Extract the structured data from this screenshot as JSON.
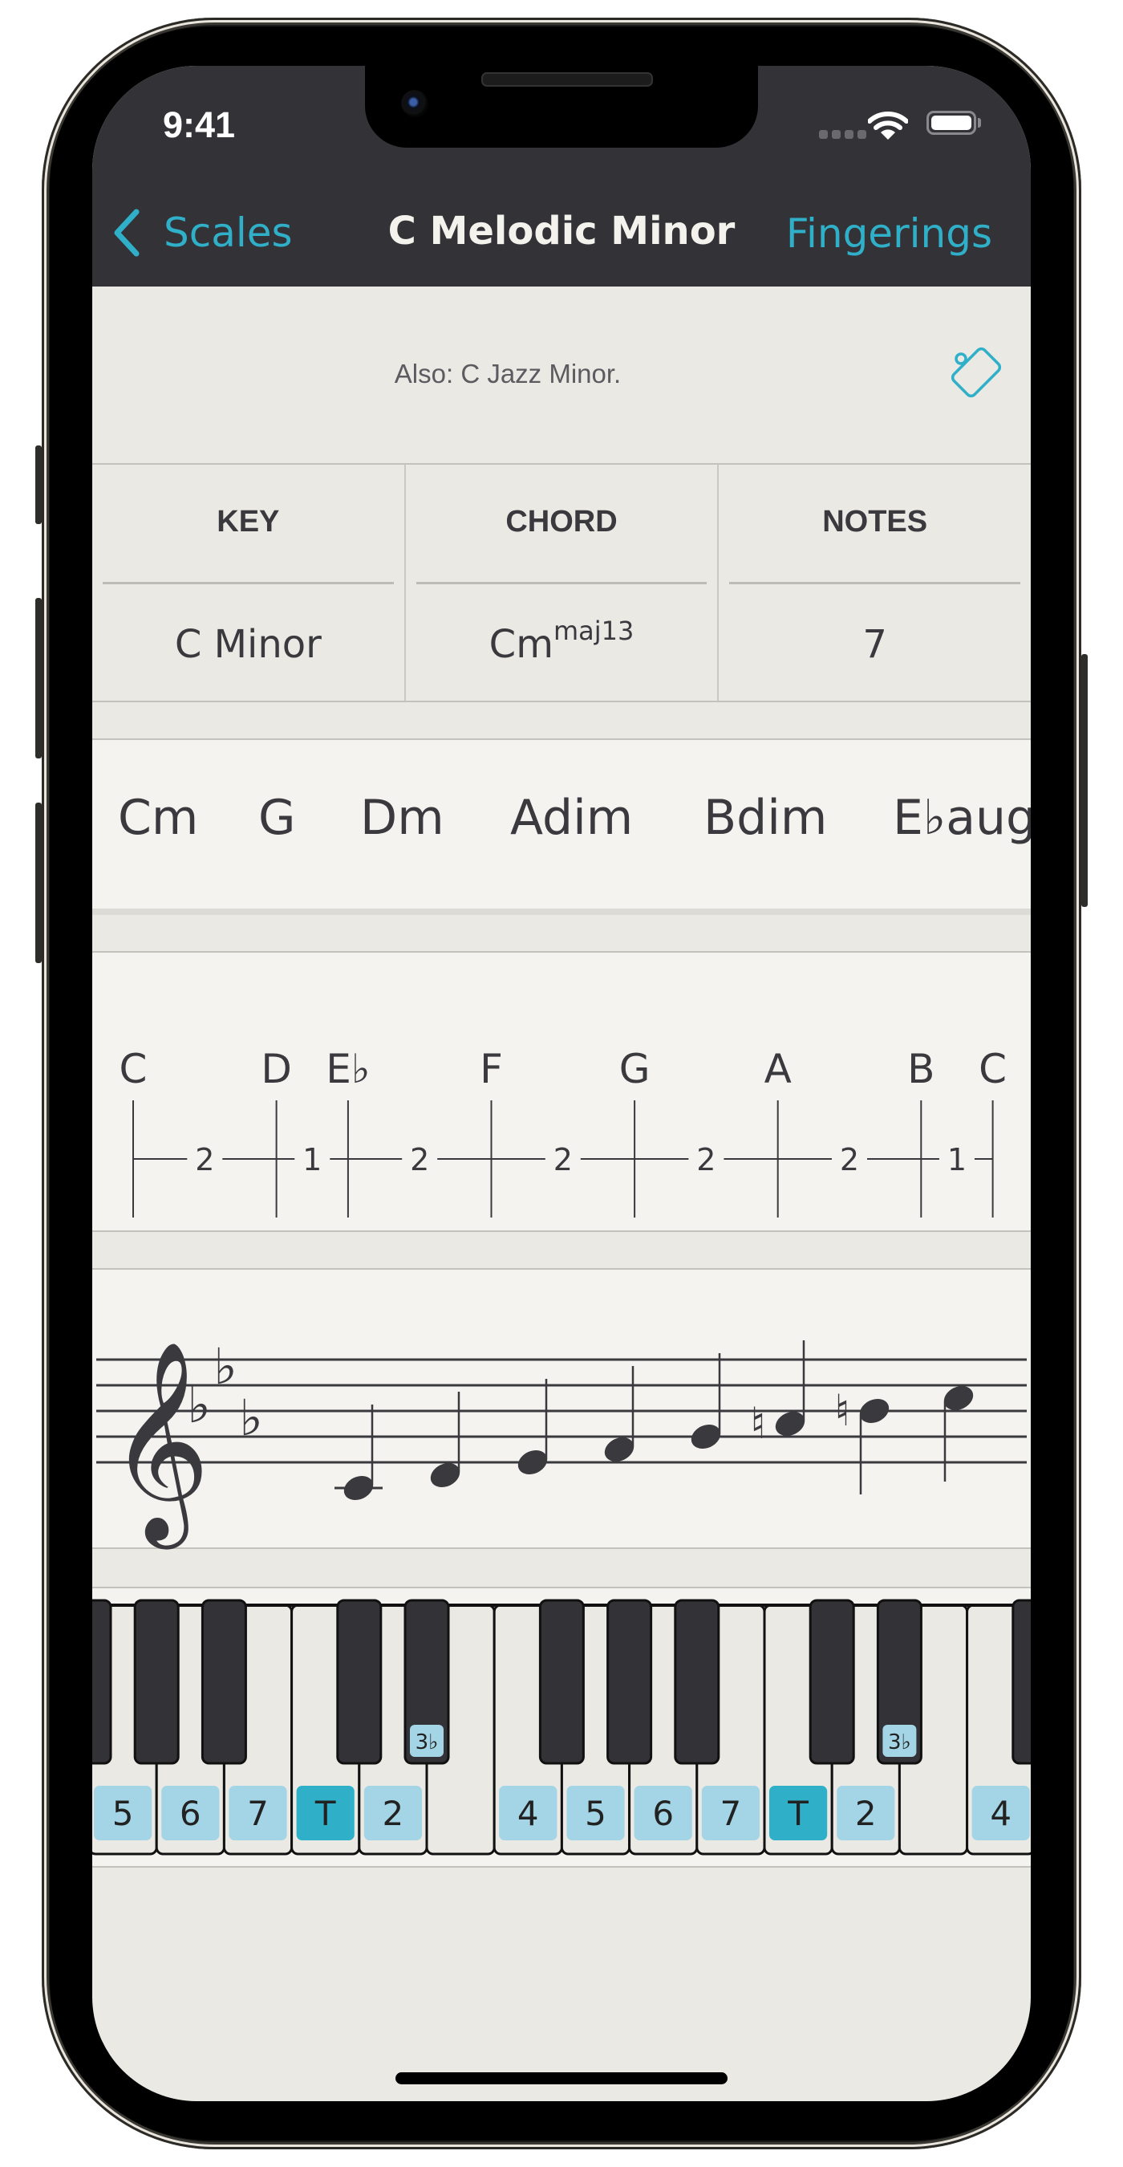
{
  "status_bar": {
    "time": "9:41",
    "signal_bars": 0,
    "wifi": "wifi-icon",
    "battery": "battery-full-icon"
  },
  "nav": {
    "back_label": "Scales",
    "title": "C Melodic Minor",
    "right_label": "Fingerings",
    "accent_color": "#2fb0c8"
  },
  "also": {
    "text": "Also: C Jazz Minor.",
    "icon": "tag-icon"
  },
  "info": {
    "columns": [
      {
        "header": "KEY",
        "value": "C Minor",
        "sup": ""
      },
      {
        "header": "CHORD",
        "value": "Cm",
        "sup": "maj13"
      },
      {
        "header": "NOTES",
        "value": "7",
        "sup": ""
      }
    ]
  },
  "chords": [
    "Cm",
    "G",
    "Dm",
    "Adim",
    "Bdim",
    "E♭aug"
  ],
  "intervals": {
    "notes": [
      "C",
      "D",
      "E♭",
      "F",
      "G",
      "A",
      "B",
      "C"
    ],
    "degrees": [
      "T",
      "2",
      "3♭",
      "4",
      "5",
      "6",
      "7",
      "T"
    ],
    "steps": [
      "2",
      "1",
      "2",
      "2",
      "2",
      "2",
      "1"
    ],
    "semitone_positions": [
      0,
      2,
      3,
      5,
      7,
      9,
      11,
      12
    ]
  },
  "staff": {
    "clef": "treble",
    "key_signature": [
      "B♭",
      "E♭",
      "A♭"
    ],
    "notes": [
      {
        "name": "C4",
        "step": -2,
        "accidental": ""
      },
      {
        "name": "D4",
        "step": -1,
        "accidental": ""
      },
      {
        "name": "E♭4",
        "step": 0,
        "accidental": ""
      },
      {
        "name": "F4",
        "step": 1,
        "accidental": ""
      },
      {
        "name": "G4",
        "step": 2,
        "accidental": ""
      },
      {
        "name": "A4",
        "step": 3,
        "accidental": "♮"
      },
      {
        "name": "B4",
        "step": 4,
        "accidental": "♮"
      },
      {
        "name": "C5",
        "step": 5,
        "accidental": ""
      }
    ]
  },
  "piano": {
    "white_keys": [
      {
        "note": "G",
        "label": "5",
        "root": false
      },
      {
        "note": "A",
        "label": "6",
        "root": false
      },
      {
        "note": "B",
        "label": "7",
        "root": false
      },
      {
        "note": "C",
        "label": "T",
        "root": true
      },
      {
        "note": "D",
        "label": "2",
        "root": false
      },
      {
        "note": "E",
        "label": "",
        "root": false
      },
      {
        "note": "F",
        "label": "4",
        "root": false
      },
      {
        "note": "G",
        "label": "5",
        "root": false
      },
      {
        "note": "A",
        "label": "6",
        "root": false
      },
      {
        "note": "B",
        "label": "7",
        "root": false
      },
      {
        "note": "C",
        "label": "T",
        "root": true
      },
      {
        "note": "D",
        "label": "2",
        "root": false
      },
      {
        "note": "E",
        "label": "",
        "root": false
      },
      {
        "note": "F",
        "label": "4",
        "root": false
      }
    ],
    "black_keys": [
      {
        "after_white": -1,
        "note": "F♯",
        "label": ""
      },
      {
        "after_white": 0,
        "note": "G♯",
        "label": ""
      },
      {
        "after_white": 1,
        "note": "A♯",
        "label": ""
      },
      {
        "after_white": 3,
        "note": "C♯",
        "label": ""
      },
      {
        "after_white": 4,
        "note": "E♭",
        "label": "3♭"
      },
      {
        "after_white": 6,
        "note": "F♯",
        "label": ""
      },
      {
        "after_white": 7,
        "note": "G♯",
        "label": ""
      },
      {
        "after_white": 8,
        "note": "A♯",
        "label": ""
      },
      {
        "after_white": 10,
        "note": "C♯",
        "label": ""
      },
      {
        "after_white": 11,
        "note": "E♭",
        "label": "3♭"
      },
      {
        "after_white": 13,
        "note": "F♯",
        "label": ""
      }
    ],
    "colors": {
      "scale_badge": "#a3d5e6",
      "root_badge": "#2fb0c8",
      "black_key": "#333237",
      "white_key": "#eae9e4"
    }
  }
}
